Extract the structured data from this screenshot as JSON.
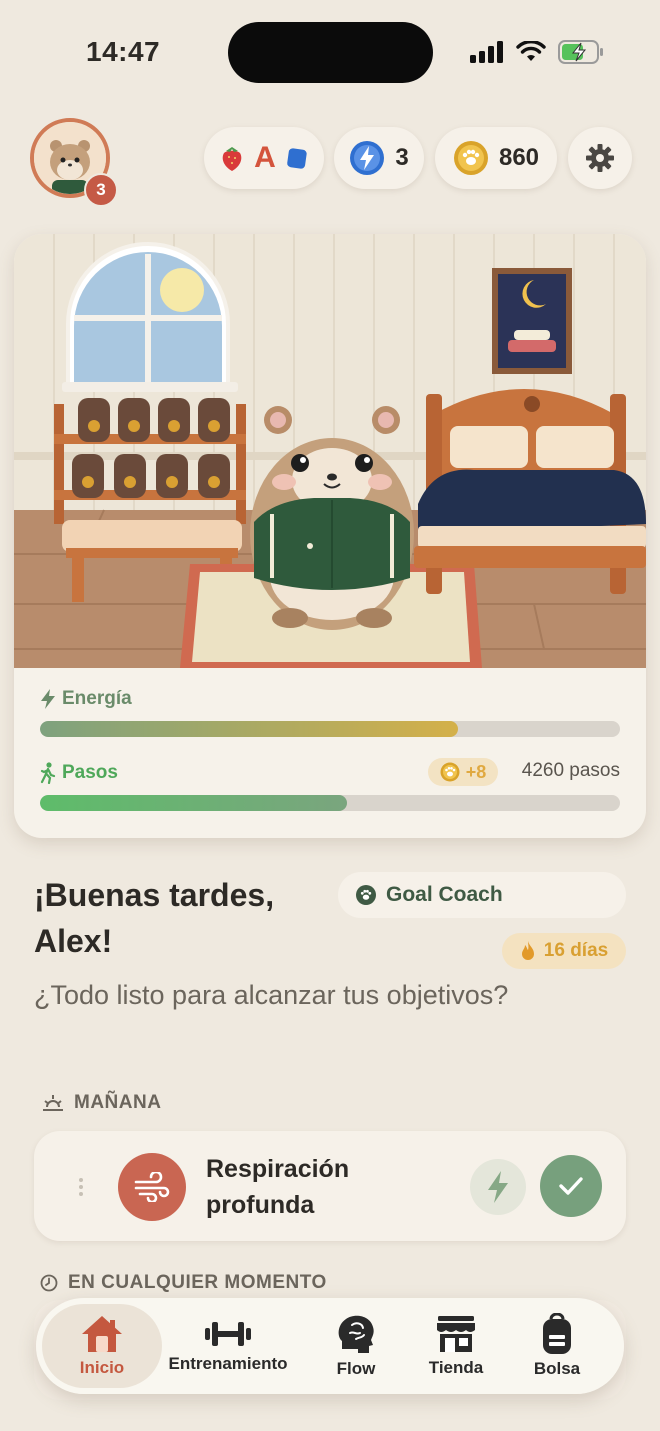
{
  "status_bar": {
    "time": "14:47"
  },
  "header": {
    "avatar_badge_count": "3",
    "badges_letter": "A",
    "energy_count": "3",
    "coin_count": "860"
  },
  "room": {
    "energy_label": "Energía",
    "energy_level": 0.72,
    "steps_label": "Pasos",
    "steps_bonus": "+8",
    "steps_count": "4260 pasos",
    "steps_level": 0.53
  },
  "greeting": {
    "title": "¡Buenas tardes, Alex!",
    "coach_label": "Goal Coach",
    "streak": "16 días",
    "subtitle": "¿Todo listo para alcanzar tus objetivos?"
  },
  "sections": {
    "morning_label": "MAÑANA",
    "anytime_label": "EN CUALQUIER MOMENTO"
  },
  "habits": [
    {
      "title": "Respiración profunda",
      "icon": "wind-icon"
    }
  ],
  "tabs": [
    {
      "label": "Inicio",
      "icon": "home-icon",
      "active": true
    },
    {
      "label": "Entrenamiento",
      "icon": "dumbbell-icon",
      "active": false
    },
    {
      "label": "Flow",
      "icon": "brain-icon",
      "active": false
    },
    {
      "label": "Tienda",
      "icon": "store-icon",
      "active": false
    },
    {
      "label": "Bolsa",
      "icon": "bag-icon",
      "active": false
    }
  ],
  "colors": {
    "background": "#efe9df",
    "accent": "#c4583f",
    "energy_bar": "#d4b04a",
    "steps_bar": "#5ebc6a",
    "complete_green": "#77a07d"
  }
}
